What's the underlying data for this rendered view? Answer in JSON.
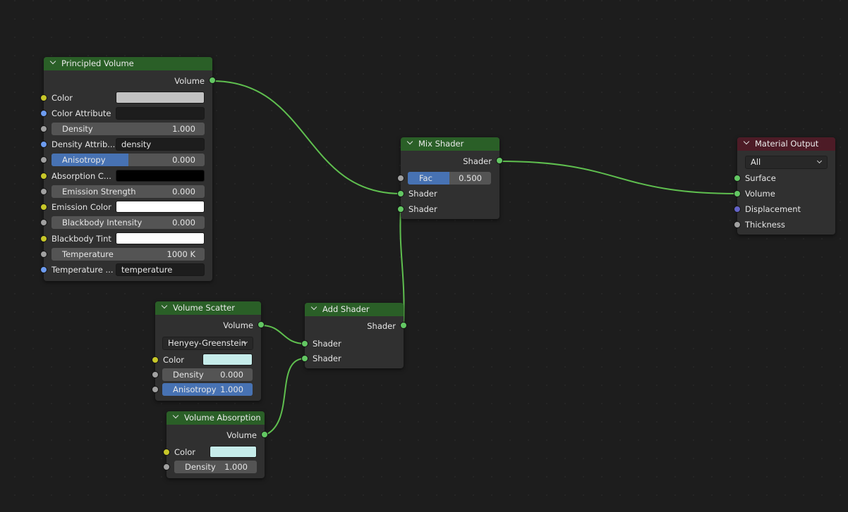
{
  "nodes": {
    "principled_volume": {
      "title": "Principled Volume",
      "output": "Volume",
      "color_label": "Color",
      "color_attribute_label": "Color Attribute",
      "density_label": "Density",
      "density_value": "1.000",
      "density_attribute_label": "Density Attrib...",
      "density_attribute_value": "density",
      "anisotropy_label": "Anisotropy",
      "anisotropy_value": "0.000",
      "anisotropy_fill": 0.5,
      "absorption_color_label": "Absorption C...",
      "emission_strength_label": "Emission Strength",
      "emission_strength_value": "0.000",
      "emission_color_label": "Emission Color",
      "blackbody_intensity_label": "Blackbody Intensity",
      "blackbody_intensity_value": "0.000",
      "blackbody_tint_label": "Blackbody Tint",
      "temperature_label": "Temperature",
      "temperature_value": "1000 K",
      "temperature_attribute_label": "Temperature ...",
      "temperature_attribute_value": "temperature"
    },
    "mix_shader": {
      "title": "Mix Shader",
      "output": "Shader",
      "fac_label": "Fac",
      "fac_value": "0.500",
      "fac_fill": 0.5,
      "input1": "Shader",
      "input2": "Shader"
    },
    "material_output": {
      "title": "Material Output",
      "target": "All",
      "surface": "Surface",
      "volume": "Volume",
      "displacement": "Displacement",
      "thickness": "Thickness"
    },
    "volume_scatter": {
      "title": "Volume Scatter",
      "output": "Volume",
      "phase": "Henyey-Greenstein",
      "color_label": "Color",
      "density_label": "Density",
      "density_value": "0.000",
      "anisotropy_label": "Anisotropy",
      "anisotropy_value": "1.000",
      "anisotropy_fill": 1.0
    },
    "add_shader": {
      "title": "Add Shader",
      "output": "Shader",
      "input1": "Shader",
      "input2": "Shader"
    },
    "volume_absorption": {
      "title": "Volume Absorption",
      "output": "Volume",
      "color_label": "Color",
      "density_label": "Density",
      "density_value": "1.000"
    }
  },
  "colors": {
    "wire": "#5fbf4f",
    "header_shader": "#2a5f27",
    "header_output": "#4d1b26",
    "socket_shader": "#63c763",
    "socket_color": "#c7c729",
    "socket_string": "#6d9cf0",
    "socket_float": "#a1a1a1",
    "socket_vector": "#6363c7",
    "slider_fill": "#4772b3",
    "principled_color": "#c2c2c2",
    "principled_color_attribute": "#1d1d1d",
    "principled_absorption": "#000000",
    "principled_emission": "#ffffff",
    "principled_blackbody_tint": "#ffffff",
    "scatter_color": "#c6ecea",
    "absorption_color": "#c6ecea"
  }
}
